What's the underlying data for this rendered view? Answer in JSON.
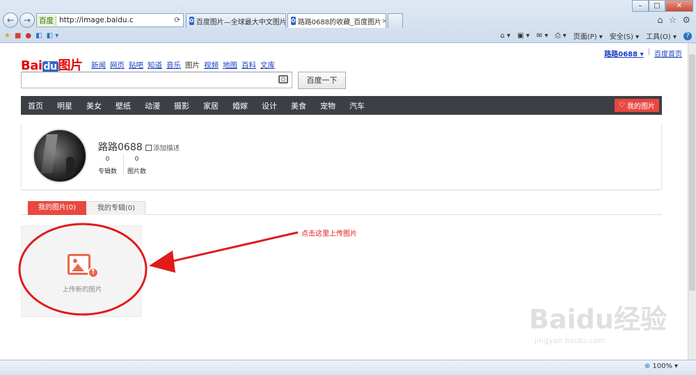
{
  "browser": {
    "address": "http://image.baidu.c",
    "search_badge": "百度",
    "tabs": [
      {
        "label": "百度图片—全球最大中文图片库"
      },
      {
        "label": "路路0688的收藏_百度图片"
      }
    ],
    "command_bar": {
      "page_menu": "页面(P)",
      "safety_menu": "安全(S)",
      "tools_menu": "工具(O)",
      "help_icon": "?"
    },
    "status": {
      "zoom": "100%"
    }
  },
  "header": {
    "logo_bai": "Bai",
    "logo_du": "du",
    "logo_pic": "图片",
    "nav_links": [
      "新闻",
      "网页",
      "贴吧",
      "知道",
      "音乐",
      "图片",
      "视频",
      "地图",
      "百科",
      "文库"
    ],
    "current_nav": "图片",
    "user_name": "路路0688",
    "home_link": "百度首页",
    "search_button": "百度一下"
  },
  "category_nav": {
    "items": [
      "首页",
      "明星",
      "美女",
      "壁纸",
      "动漫",
      "摄影",
      "家居",
      "婚嫁",
      "设计",
      "美食",
      "宠物",
      "汽车"
    ],
    "my_pics_button": "我的图片"
  },
  "profile": {
    "name": "路路0688",
    "add_description": "添加描述",
    "albums_count": "0",
    "albums_label": "专辑数",
    "pictures_count": "0",
    "pictures_label": "图片数"
  },
  "tabs": {
    "my_pictures": "我的图片(0)",
    "my_albums": "我的专辑(0)"
  },
  "upload": {
    "label": "上传新的图片"
  },
  "annotation": {
    "hint": "点击这里上传图片"
  },
  "watermark": {
    "brand": "Baidu经验",
    "url": "jingyan.baidu.com"
  },
  "colors": {
    "accent_red": "#e8483f",
    "nav_dark": "#3d3f46",
    "link_blue": "#1a3dc1"
  }
}
